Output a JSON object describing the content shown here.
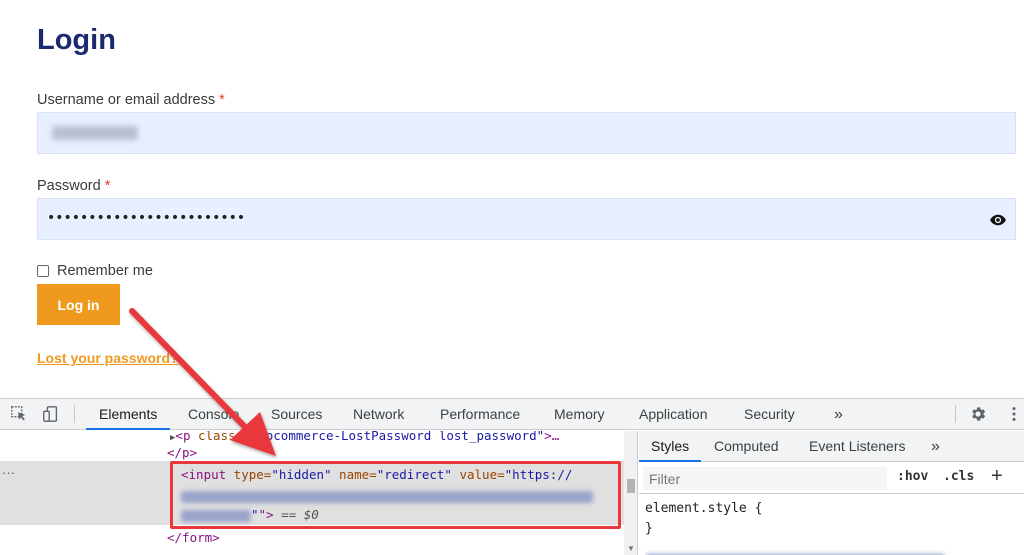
{
  "login": {
    "title": "Login",
    "username_label": "Username or email address",
    "required_mark": "*",
    "password_label": "Password",
    "password_value": "••••••••••••••••••••••••",
    "remember_label": "Remember me",
    "login_button": "Log in",
    "lost_password_link": "Lost your password?"
  },
  "devtools": {
    "tabs": [
      "Elements",
      "Console",
      "Sources",
      "Network",
      "Performance",
      "Memory",
      "Application",
      "Security"
    ],
    "more": "»",
    "dom": {
      "line1_tag": "<p",
      "line1_attr": " class=",
      "line1_val": "\"woocommerce-LostPassword lost_password\"",
      "line1_end": ">…",
      "line2": "</p>",
      "row_ellipsis": "···",
      "sel_open": "<input",
      "sel_type_n": " type=",
      "sel_type_v": "\"hidden\"",
      "sel_name_n": " name=",
      "sel_name_v": "\"redirect\"",
      "sel_value_n": " value=",
      "sel_value_v": "\"https://",
      "sel_close": "\">",
      "sel_eq": " == $0",
      "line_form": "</form>"
    },
    "styles_tabs": [
      "Styles",
      "Computed",
      "Event Listeners"
    ],
    "styles_more": "»",
    "filter_placeholder": "Filter",
    "hov": ":hov",
    "cls": ".cls",
    "plus": "+",
    "element_style_open": "element.style {",
    "element_style_close": "}"
  },
  "colors": {
    "accent": "#f0991f",
    "title": "#1b2a6e",
    "input_bg": "#e8efff",
    "annotation": "#e8383b"
  },
  "icons": [
    "eye-icon",
    "inspect-element-icon",
    "device-toolbar-icon",
    "settings-gear-icon",
    "kebab-menu-icon"
  ]
}
